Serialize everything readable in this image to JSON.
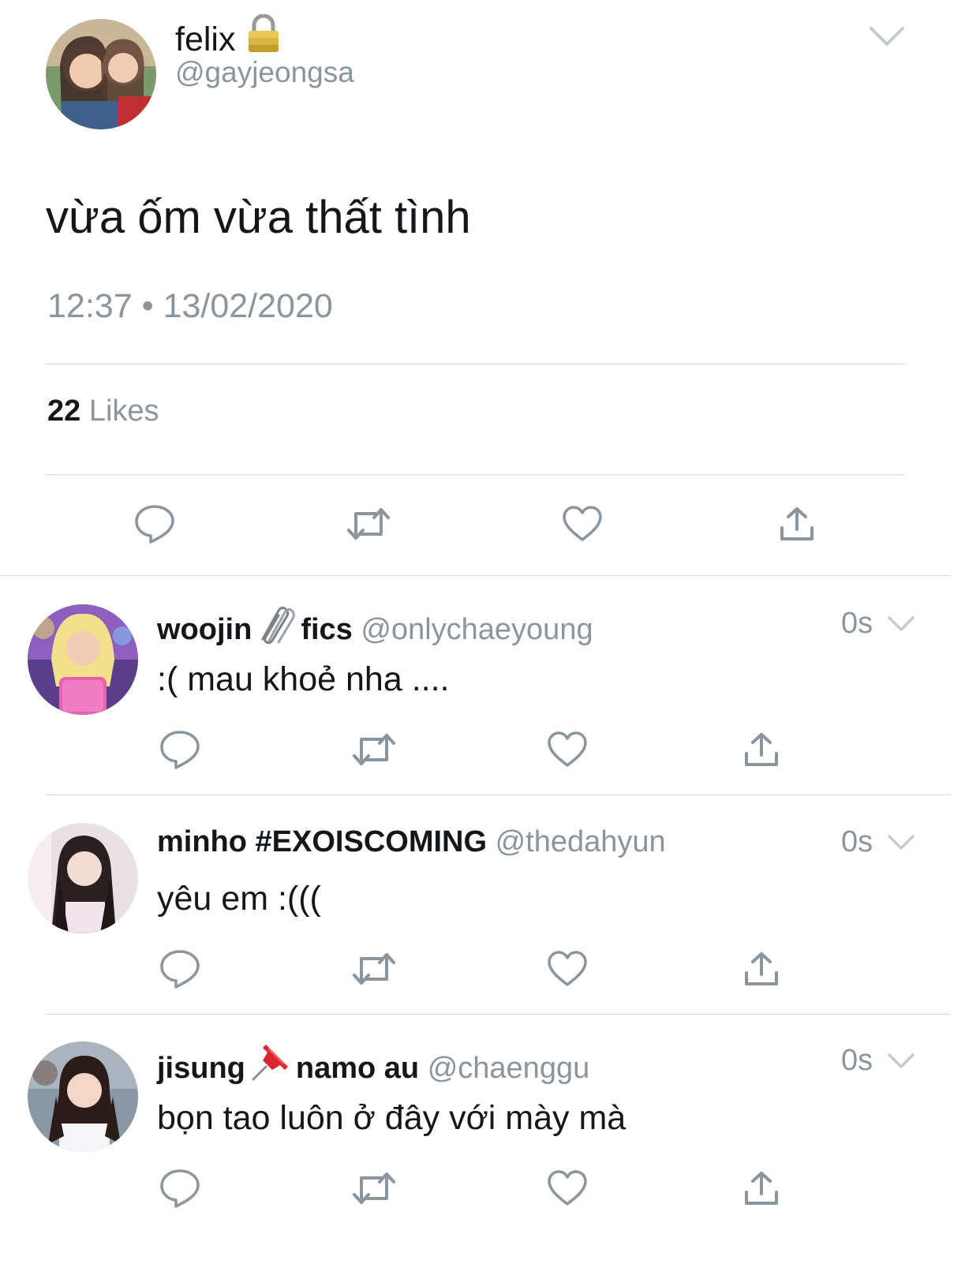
{
  "main_tweet": {
    "author": {
      "name": "felix",
      "handle": "@gayjeongsa",
      "protected_icon": "lock-icon"
    },
    "text": "vừa ốm vừa thất tình",
    "time": "12:37",
    "separator": "•",
    "date": "13/02/2020",
    "likes": {
      "count": "22",
      "label": "Likes"
    },
    "actions": [
      "reply-icon",
      "retweet-icon",
      "like-icon",
      "share-icon"
    ],
    "menu_icon": "chevron-down-icon"
  },
  "replies": [
    {
      "name": "woojin",
      "emoji_icon": "paperclip-icon",
      "name_suffix": "fics",
      "handle": "@onlychaeyoung",
      "time": "0s",
      "text": ":( mau khoẻ nha ...."
    },
    {
      "name": "minho #EXOISCOMING",
      "emoji_icon": "",
      "name_suffix": "",
      "handle": "@thedahyun",
      "time": "0s",
      "text": "yêu em :((("
    },
    {
      "name": "jisung",
      "emoji_icon": "pushpin-icon",
      "name_suffix": "namo au",
      "handle": "@chaenggu",
      "time": "0s",
      "text": "bọn tao luôn ở đây với mày mà"
    }
  ],
  "colors": {
    "text": "#14171a",
    "secondary": "#8b959e",
    "icon": "#8b959e",
    "divider": "#d5d9dc",
    "background": "#ffffff"
  }
}
